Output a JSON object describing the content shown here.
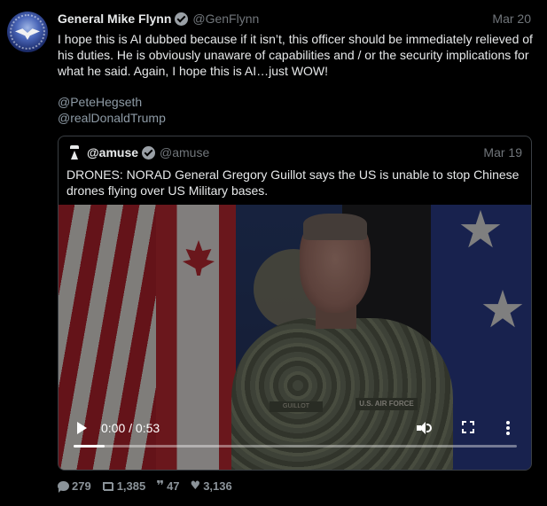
{
  "tweet": {
    "author_name": "General Mike Flynn",
    "author_handle": "@GenFlynn",
    "date": "Mar 20",
    "text": "I hope this is AI dubbed because if it isn’t, this officer should be immediately relieved of his duties. He is obviously unaware of capabilities and / or the security implications for what he said. Again, I hope this is AI…just WOW!",
    "mentions": [
      "@PeteHegseth",
      "@realDonaldTrump"
    ]
  },
  "quoted_tweet": {
    "author_name": "@amuse",
    "author_handle": "@amuse",
    "date": "Mar 19",
    "text": "DRONES: NORAD General Gregory Guillot says the US is unable to stop Chinese drones flying over US Military bases.",
    "video": {
      "time_display": "0:00 / 0:53",
      "progress_fraction": 0.07,
      "patch_name": "GUILLOT",
      "patch_branch": "U.S. AIR FORCE"
    }
  },
  "actions": {
    "replies": "279",
    "retweets": "1,385",
    "quotes": "47",
    "likes": "3,136"
  },
  "colors": {
    "background": "#000000",
    "text": "#e7e9ea",
    "muted": "#71767b",
    "link": "#8e9ba6",
    "border": "#3a3f44"
  },
  "icons": [
    "verified-icon",
    "play-icon",
    "volume-icon",
    "fullscreen-icon",
    "more-options-icon",
    "reply-icon",
    "retweet-icon",
    "quote-icon",
    "like-icon"
  ]
}
